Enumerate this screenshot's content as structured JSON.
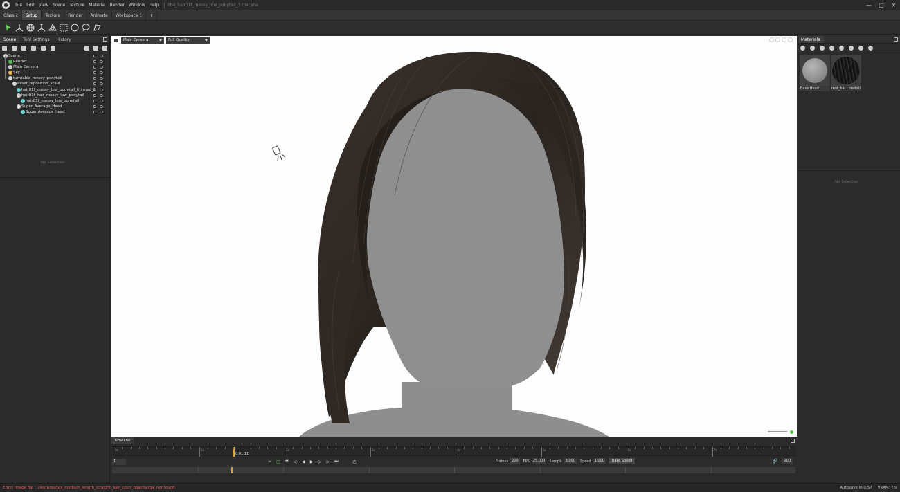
{
  "menubar": {
    "items": [
      "File",
      "Edit",
      "View",
      "Scene",
      "Texture",
      "Material",
      "Render",
      "Window",
      "Help"
    ],
    "document_title": "tb4_hair01f_messy_low_ponytail_3.tbscene"
  },
  "workspace_tabs": [
    "Classic",
    "Setup",
    "Texture",
    "Render",
    "Animate",
    "Workspace 1",
    "+"
  ],
  "active_workspace": "Setup",
  "left_panel": {
    "tabs": [
      "Scene",
      "Tool Settings",
      "History"
    ],
    "active_tab": "Scene",
    "tree": [
      {
        "label": "Scene",
        "icon": "globe-icon",
        "color": "#cfcfcf"
      },
      {
        "label": "Render",
        "icon": "render-icon",
        "color": "#4fc24a"
      },
      {
        "label": "Main Camera",
        "icon": "camera-icon",
        "color": "#cfcfcf"
      },
      {
        "label": "Sky",
        "icon": "sky-icon",
        "color": "#e0b040"
      },
      {
        "label": "turntable_messy_ponytail",
        "icon": "turntable-icon",
        "color": "#d8d8d8"
      },
      {
        "label": "asset_reposition_scale",
        "icon": "transform-icon",
        "color": "#d8d8d8"
      },
      {
        "label": "hair01f_messy_low_ponytail_thinned_1",
        "icon": "mesh-icon",
        "color": "#6ad0c8"
      },
      {
        "label": "hair01f_hair_messy_low_ponytail",
        "icon": "mesh-icon",
        "color": "#d8d8d8"
      },
      {
        "label": "hair01f_messy_low_ponytail",
        "icon": "mesh-icon",
        "color": "#6ad0c8"
      },
      {
        "label": "Super_Average_Head",
        "icon": "mesh-icon",
        "color": "#d8d8d8"
      },
      {
        "label": "Super Average Head",
        "icon": "mesh-icon",
        "color": "#6ad0c8"
      }
    ],
    "properties_empty": "No Selection"
  },
  "viewport": {
    "camera": "Main Camera",
    "quality": "Full Quality"
  },
  "right_panel": {
    "title": "Materials",
    "materials": [
      {
        "label": "Base Head"
      },
      {
        "label": "mat_hai...onytail"
      }
    ],
    "properties_empty": "No Selection"
  },
  "timeline": {
    "tab": "Timeline",
    "ticks": [
      "0s",
      "1s",
      "2s",
      "3s",
      "4s",
      "5s",
      "6s",
      "7s"
    ],
    "current_time": "0:01.11",
    "current_frame": "1",
    "frames_label": "Frames",
    "frames": "200",
    "fps_label": "FPS",
    "fps": "25.000",
    "length_label": "Length",
    "length": "8.000",
    "speed_label": "Speed",
    "speed": "1.000",
    "bake_label": "Bake Speed",
    "end_frame": "200"
  },
  "statusbar": {
    "error": "Error: image file '../Textures/tex_medium_length_straight_hair_color_opacity.tga' not found",
    "autosave": "Autosave in 0:57",
    "vram": "VRAM: 7%"
  },
  "colors": {
    "accent_green": "#5fce4a",
    "playhead": "#d0a540",
    "error": "#e85a5a"
  }
}
